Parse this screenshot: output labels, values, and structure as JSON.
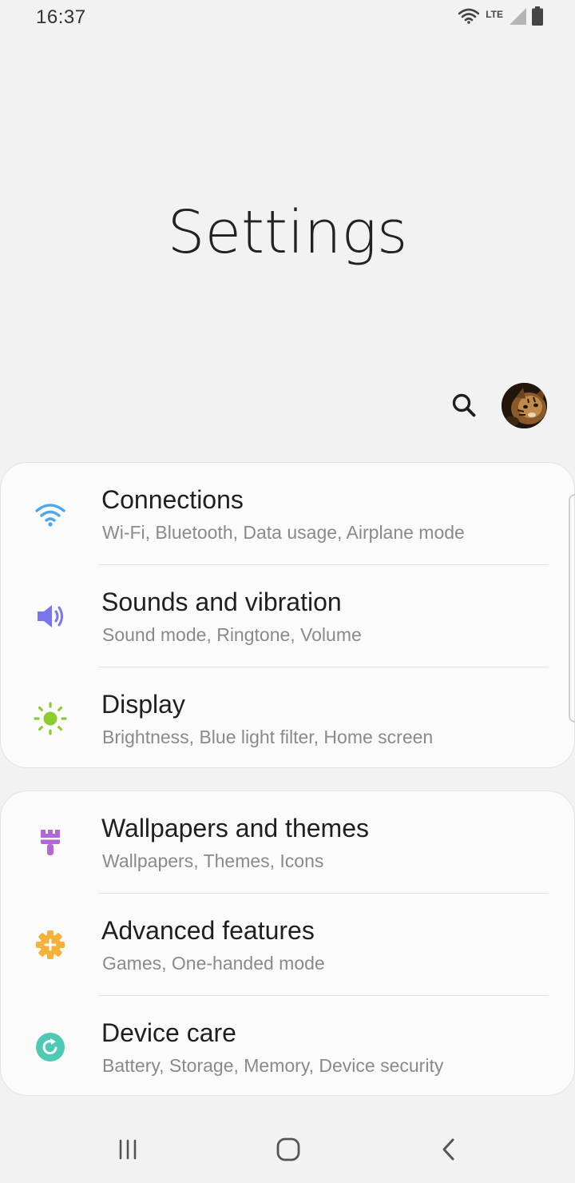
{
  "status_bar": {
    "time": "16:37",
    "network_label": "LTE"
  },
  "page": {
    "title": "Settings"
  },
  "header_actions": {
    "search_icon": "search-icon",
    "avatar": "profile-avatar"
  },
  "sections": [
    {
      "items": [
        {
          "title": "Connections",
          "subtitle": "Wi-Fi, Bluetooth, Data usage, Airplane mode",
          "icon": "wifi-icon",
          "color": "#4fa6ee"
        },
        {
          "title": "Sounds and vibration",
          "subtitle": "Sound mode, Ringtone, Volume",
          "icon": "volume-icon",
          "color": "#7b77ea"
        },
        {
          "title": "Display",
          "subtitle": "Brightness, Blue light filter, Home screen",
          "icon": "brightness-icon",
          "color": "#8ccc2e"
        }
      ]
    },
    {
      "items": [
        {
          "title": "Wallpapers and themes",
          "subtitle": "Wallpapers, Themes, Icons",
          "icon": "paintbrush-icon",
          "color": "#b567d9"
        },
        {
          "title": "Advanced features",
          "subtitle": "Games, One-handed mode",
          "icon": "gear-plus-icon",
          "color": "#f5b13a"
        },
        {
          "title": "Device care",
          "subtitle": "Battery, Storage, Memory, Device security",
          "icon": "device-care-icon",
          "color": "#4ec9b4"
        }
      ]
    }
  ],
  "nav_bar": {
    "recents_icon": "recents-icon",
    "home_icon": "home-icon",
    "back_icon": "back-icon"
  }
}
